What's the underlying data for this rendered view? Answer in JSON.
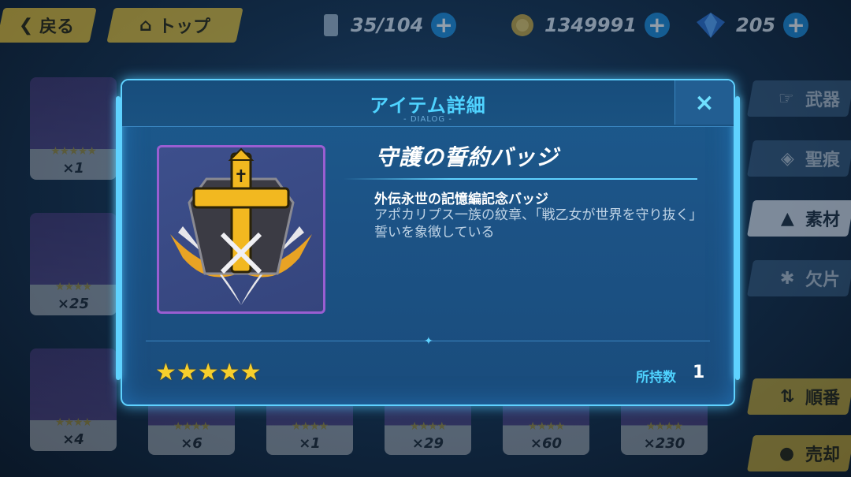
{
  "topbar": {
    "back_label": "戻る",
    "top_label": "トップ",
    "stamina": "35/104",
    "coins": "1349991",
    "crystals": "205"
  },
  "side_tabs": [
    {
      "label": "武器",
      "icon": "gun-icon"
    },
    {
      "label": "聖痕",
      "icon": "stigmata-icon"
    },
    {
      "label": "素材",
      "icon": "material-icon"
    },
    {
      "label": "欠片",
      "icon": "puzzle-icon"
    }
  ],
  "side_actions": {
    "sort_label": "順番",
    "sell_label": "売却"
  },
  "grid_counts": {
    "col1": [
      "×1",
      "×25",
      "×4"
    ],
    "bottom": [
      "×6",
      "×1",
      "×29",
      "×60",
      "×230"
    ]
  },
  "dialog": {
    "title": "アイテム詳細",
    "subtitle": "- DIALOG -",
    "close_label": "×",
    "item_name": "守護の誓約バッジ",
    "desc_head": "外伝永世の記憶編記念バッジ",
    "desc_body": "アポカリプス一族の紋章、「戦乙女が世界を守り抜く」誓いを象徴している",
    "rarity": 5,
    "stars": "★★★★★",
    "owned_label": "所持数",
    "owned_value": "1"
  },
  "colors": {
    "accent": "#4fd3ff",
    "dialog_bg": "#1b5a8d",
    "gold": "#f6cf2c",
    "purple_frame": "#9a5ed1"
  }
}
